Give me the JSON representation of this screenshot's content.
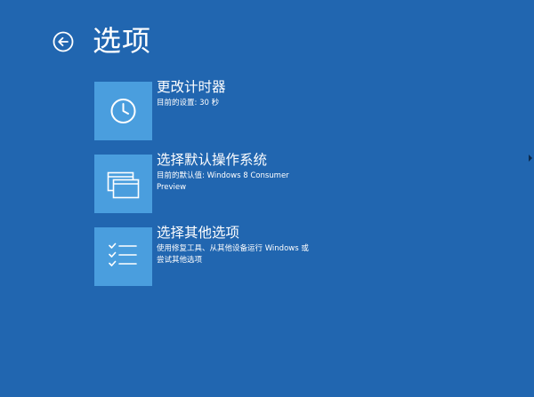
{
  "header": {
    "title": "选项",
    "back_icon": "back-arrow-circle-icon"
  },
  "options": [
    {
      "title": "更改计时器",
      "description": "目前的设置: 30 秒",
      "icon": "clock-icon"
    },
    {
      "title": "选择默认操作系统",
      "description": "目前的默认值: Windows 8 Consumer Preview",
      "icon": "windows-stack-icon"
    },
    {
      "title": "选择其他选项",
      "description": "使用修复工具、从其他设备运行 Windows 或尝试其他选项",
      "icon": "checklist-icon"
    }
  ],
  "colors": {
    "background": "#2166b0",
    "tile": "#4a9ede",
    "text": "#ffffff"
  }
}
